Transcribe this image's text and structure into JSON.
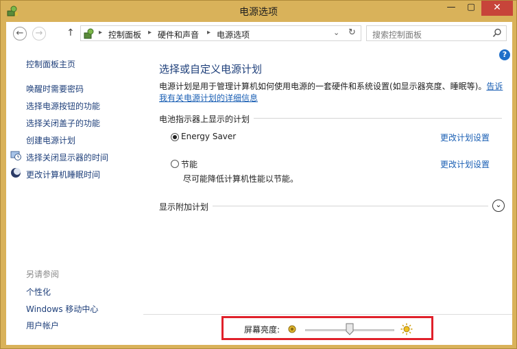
{
  "window": {
    "title": "电源选项",
    "controls": {
      "minimize": "—",
      "maximize": "▢",
      "close": "✕"
    }
  },
  "nav": {
    "back": "←",
    "forward": "→",
    "up": "↑",
    "breadcrumbs": [
      "控制面板",
      "硬件和声音",
      "电源选项"
    ],
    "separator": "▸",
    "dropdown": "⌄",
    "refresh": "↻",
    "search_placeholder": "搜索控制面板"
  },
  "help": "?",
  "sidebar": {
    "home": "控制面板主页",
    "items": [
      {
        "label": "唤醒时需要密码",
        "icon": ""
      },
      {
        "label": "选择电源按钮的功能",
        "icon": ""
      },
      {
        "label": "选择关闭盖子的功能",
        "icon": ""
      },
      {
        "label": "创建电源计划",
        "icon": ""
      },
      {
        "label": "选择关闭显示器的时间",
        "icon": "monitor-clock-icon"
      },
      {
        "label": "更改计算机睡眠时间",
        "icon": "moon-icon"
      }
    ],
    "see_also_title": "另请参阅",
    "see_also": [
      "个性化",
      "Windows 移动中心",
      "用户帐户"
    ]
  },
  "main": {
    "title": "选择或自定义电源计划",
    "desc_prefix": "电源计划是用于管理计算机如何使用电源的一套硬件和系统设置(如显示器亮度、睡眠等)。",
    "desc_link1": "告诉",
    "desc_link2": "我有关电源计划的详细信息",
    "section_battery": "电池指示器上显示的计划",
    "plans": [
      {
        "name": "Energy Saver",
        "selected": true,
        "description": "",
        "link": "更改计划设置"
      },
      {
        "name": "节能",
        "selected": false,
        "description": "尽可能降低计算机性能以节能。",
        "link": "更改计划设置"
      }
    ],
    "section_more": "显示附加计划",
    "expand": "⌄"
  },
  "brightness": {
    "label": "屏幕亮度:",
    "level": 0.5
  },
  "colors": {
    "link": "#1a5fb4",
    "nav_link": "#1e3f7a",
    "highlight_box": "#e0202a",
    "close_button": "#c7443a",
    "window_frame": "#d9b25a"
  }
}
